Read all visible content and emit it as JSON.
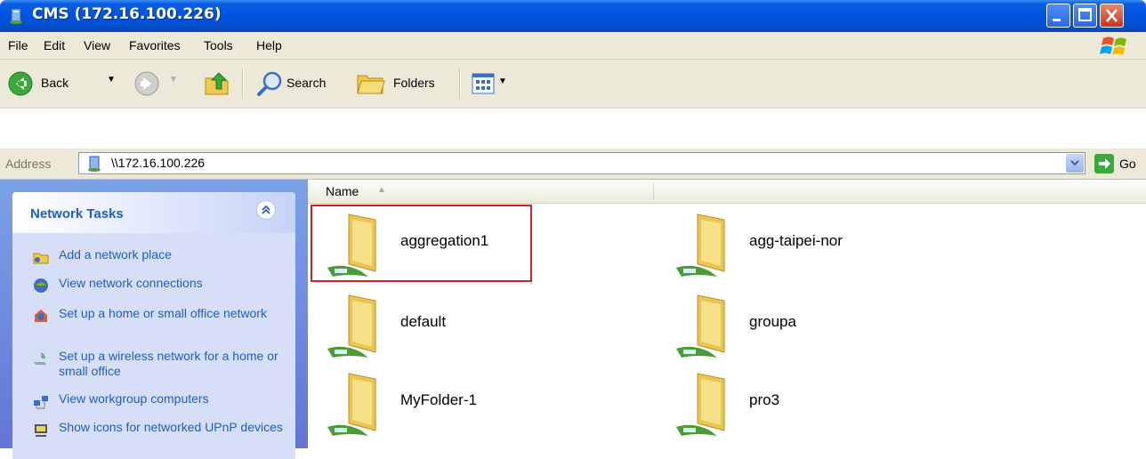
{
  "window": {
    "title": "CMS (172.16.100.226)"
  },
  "menu": [
    "File",
    "Edit",
    "View",
    "Favorites",
    "Tools",
    "Help"
  ],
  "toolbar": {
    "back_label": "Back",
    "search_label": "Search",
    "folders_label": "Folders"
  },
  "address": {
    "label": "Address",
    "value": "\\\\172.16.100.226",
    "go_label": "Go"
  },
  "network_tasks": {
    "title": "Network Tasks",
    "items": [
      {
        "label": "Add a network place",
        "icon": "add-network-place-icon"
      },
      {
        "label": "View network connections",
        "icon": "network-connections-icon"
      },
      {
        "label": "Set up a home or small office network",
        "icon": "home-network-icon"
      },
      {
        "label": "Set up a wireless network for a home or small office",
        "icon": "wireless-network-icon"
      },
      {
        "label": "View workgroup computers",
        "icon": "workgroup-computers-icon"
      },
      {
        "label": "Show icons for networked UPnP devices",
        "icon": "upnp-devices-icon"
      }
    ]
  },
  "columns": {
    "name": "Name"
  },
  "shares": [
    {
      "name": "aggregation1",
      "selected": true
    },
    {
      "name": "agg-taipei-nor"
    },
    {
      "name": "default"
    },
    {
      "name": "groupa"
    },
    {
      "name": "MyFolder-1"
    },
    {
      "name": "pro3"
    }
  ],
  "colors": {
    "titlebar": "#0054e3",
    "task_link": "#215dc6",
    "selection_frame": "#cc2222"
  }
}
